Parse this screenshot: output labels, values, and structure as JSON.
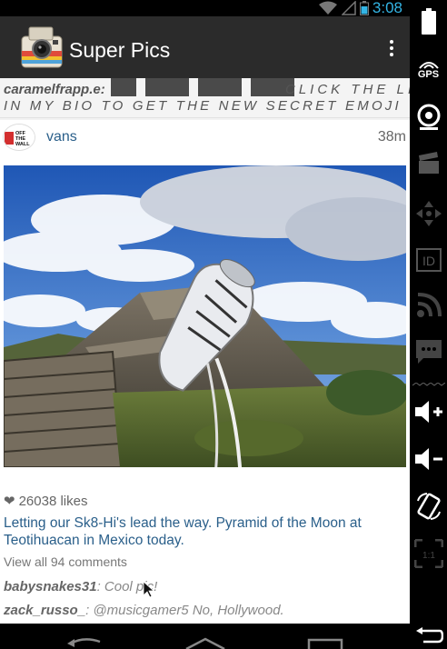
{
  "status_bar": {
    "time": "3:08",
    "icons": [
      "wifi-icon",
      "signal-icon",
      "battery-icon"
    ]
  },
  "action_bar": {
    "app_title": "Super Pics",
    "logo_icon": "polaroid-camera-icon",
    "menu_icon": "overflow-menu-icon"
  },
  "previous_comment": {
    "user": "caramelfrapp.e",
    "text_right": "CLICK THE LI",
    "text_line2": "IN MY BIO TO GET THE NEW SECRET EMOJI"
  },
  "post": {
    "avatar_text": "OFF THE WALL",
    "username": "vans",
    "time": "38m",
    "likes": "26038 likes",
    "caption": "Letting our Sk8-Hi's lead the way. Pyramid of the Moon at Teotihuacan in Mexico today.",
    "view_comments": "View all 94 comments",
    "comments": [
      {
        "user": "babysnakes31",
        "text": ": Cool pic!"
      },
      {
        "user": "zack_russo_",
        "text": ": @musicgamer5 No, Hollywood."
      }
    ]
  },
  "side_panel": {
    "gps_label": "GPS",
    "id_label": "ID",
    "scale_label": "1:1"
  },
  "colors": {
    "accent": "#33b5e5",
    "link": "#2a5f8a",
    "action_bar": "#2b2b2b"
  }
}
